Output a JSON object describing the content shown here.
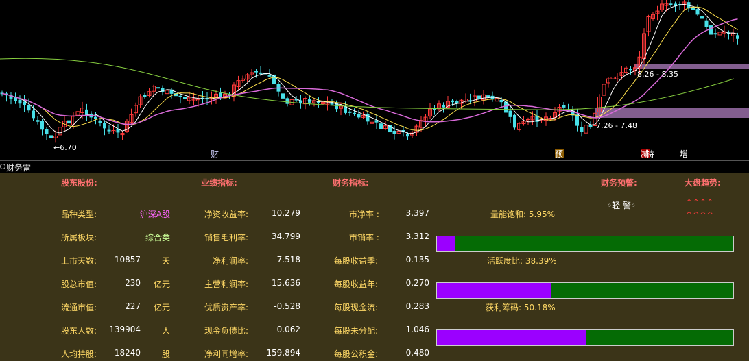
{
  "chart": {
    "low_label": "←6.70",
    "zone_high_label": "8.26 - 8.35",
    "zone_low_label": "7.26 - 7.48",
    "markers": [
      {
        "text": "财",
        "color": "#d0d0ff",
        "bg": ""
      },
      {
        "text": "预",
        "color": "#ffffff",
        "bg": "#8a5a00"
      },
      {
        "text": "减",
        "color": "#ffffff",
        "bg": "#aa0000"
      },
      {
        "text": "持",
        "color": "#ffffff",
        "bg": ""
      },
      {
        "text": "增",
        "color": "#ffffff",
        "bg": ""
      }
    ],
    "colors": {
      "up": "#ff3b3b",
      "down": "#48e0e8",
      "ma5": "#ffffff",
      "ma10": "#ffe14d",
      "ma20": "#d96ad9",
      "ma60": "#88d040",
      "zone": "#9a6fa8"
    }
  },
  "divider": {
    "title": "财务雷"
  },
  "sections": {
    "shareholder": "股东股份:",
    "performance": "业绩指标:",
    "financial": "财务指标:",
    "warning": "财务预警:",
    "market": "大盘趋势:"
  },
  "col1": [
    {
      "label": "品种类型:",
      "value": "沪深A股",
      "unit": ""
    },
    {
      "label": "所属板块:",
      "value": "综合类",
      "unit": ""
    },
    {
      "label": "上市天数:",
      "value": "10857",
      "unit": "天"
    },
    {
      "label": "股总市值:",
      "value": "230",
      "unit": "亿元"
    },
    {
      "label": "流通市值:",
      "value": "227",
      "unit": "亿元"
    },
    {
      "label": "股东人数:",
      "value": "139904",
      "unit": "人"
    },
    {
      "label": "人均持股:",
      "value": "18240",
      "unit": "股"
    }
  ],
  "col2": [
    {
      "label": "净资收益率:",
      "value": "10.279"
    },
    {
      "label": "销售毛利率:",
      "value": "34.799"
    },
    {
      "label": "净利润率:",
      "value": "7.518"
    },
    {
      "label": "主营利润率:",
      "value": "15.636"
    },
    {
      "label": "优质资产率:",
      "value": "-0.528"
    },
    {
      "label": "现金负债比:",
      "value": "0.062"
    },
    {
      "label": "净利同增率:",
      "value": "159.894"
    }
  ],
  "col3": [
    {
      "label": "市净率 :",
      "value": "3.397"
    },
    {
      "label": "市销率 :",
      "value": "3.312"
    },
    {
      "label": "每股收益季:",
      "value": "0.135"
    },
    {
      "label": "每股收益年:",
      "value": "0.270"
    },
    {
      "label": "每股现金流:",
      "value": "0.283"
    },
    {
      "label": "每股未分配:",
      "value": "1.046"
    },
    {
      "label": "每股公积金:",
      "value": "0.480"
    }
  ],
  "warning_text": "◦轻 警◦",
  "trend_symbols": [
    "^^^^",
    "^^^^"
  ],
  "bars": [
    {
      "label": "量能饱和:",
      "value": "5.95%",
      "fraction": 0.0595
    },
    {
      "label": "活跃度比:",
      "value": "38.39%",
      "fraction": 0.3839
    },
    {
      "label": "获利筹码:",
      "value": "50.18%",
      "fraction": 0.5018
    }
  ]
}
